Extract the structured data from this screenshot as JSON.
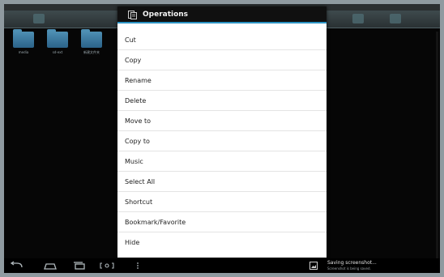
{
  "dialog": {
    "title": "Operations",
    "items": [
      {
        "label": "Cut"
      },
      {
        "label": "Copy"
      },
      {
        "label": "Rename"
      },
      {
        "label": "Delete"
      },
      {
        "label": "Move to"
      },
      {
        "label": "Copy to"
      },
      {
        "label": "Music"
      },
      {
        "label": "Select All"
      },
      {
        "label": "Shortcut"
      },
      {
        "label": "Bookmark/Favorite"
      },
      {
        "label": "Hide"
      }
    ]
  },
  "folders": [
    {
      "label": "media"
    },
    {
      "label": "sd-ext"
    },
    {
      "label": "新建文件夹"
    }
  ],
  "notification": {
    "title": "Saving screenshot...",
    "subtitle": "Screenshot is being saved."
  },
  "nav_icons": [
    "back-icon",
    "home-icon",
    "recent-apps-icon",
    "screenshot-icon",
    "menu-icon"
  ],
  "colors": {
    "dialog_header": "#101010",
    "dialog_accent": "#2c93c4",
    "folder": "#3b7aa1"
  }
}
